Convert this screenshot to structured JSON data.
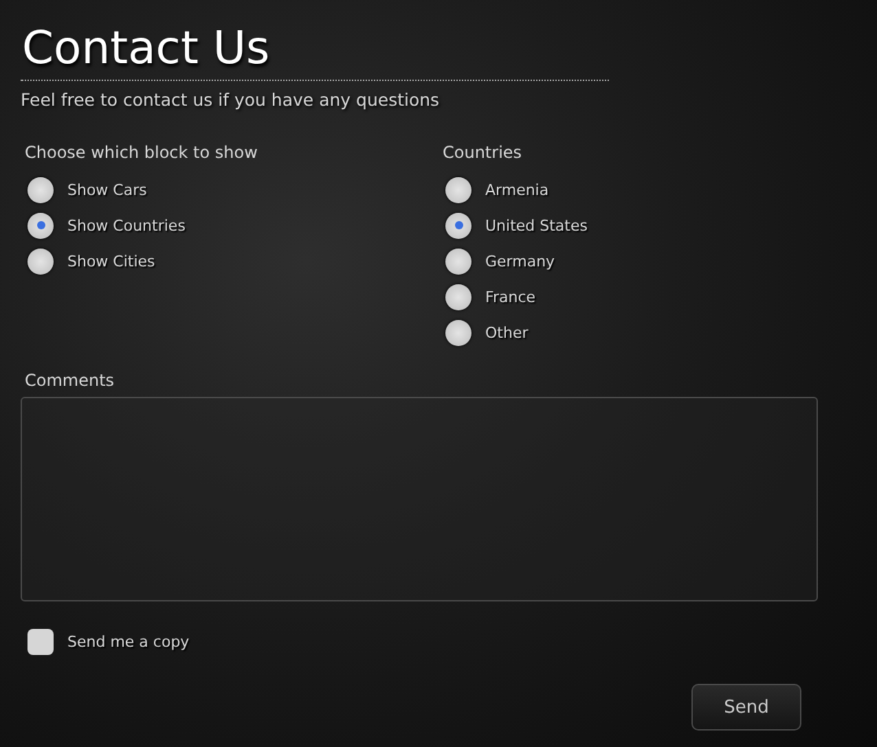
{
  "title": "Contact Us",
  "subtitle": "Feel free to contact us if you have any questions",
  "groups": [
    {
      "label": "Choose which block to show",
      "options": [
        {
          "label": "Show Cars",
          "selected": false
        },
        {
          "label": "Show Countries",
          "selected": true
        },
        {
          "label": "Show Cities",
          "selected": false
        }
      ]
    },
    {
      "label": "Countries",
      "options": [
        {
          "label": "Armenia",
          "selected": false
        },
        {
          "label": "United States",
          "selected": true
        },
        {
          "label": "Germany",
          "selected": false
        },
        {
          "label": "France",
          "selected": false
        },
        {
          "label": "Other",
          "selected": false
        }
      ]
    }
  ],
  "comments": {
    "label": "Comments"
  },
  "copy": {
    "label": "Send me a copy",
    "checked": false
  },
  "buttons": [
    "Send"
  ]
}
